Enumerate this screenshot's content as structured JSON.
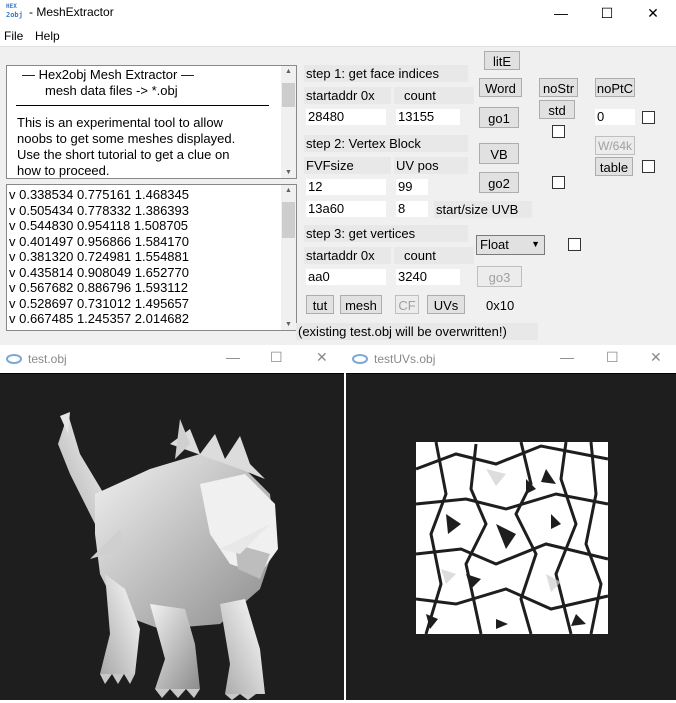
{
  "window": {
    "icon_text_top": "HEX",
    "icon_text_bottom": "2obj",
    "title": "- MeshExtractor",
    "minimize": "—",
    "maximize": "☐",
    "close": "✕"
  },
  "menu": {
    "file": "File",
    "help": "Help"
  },
  "info_panel": {
    "heading_line1": "—   Hex2obj Mesh Extractor   —",
    "heading_line2": "mesh data files -> *.obj",
    "body_lines": [
      "This is an experimental tool to allow",
      "noobs to get some meshes displayed.",
      "Use the short tutorial to get a clue on",
      "how to proceed."
    ]
  },
  "vertex_list": [
    "v 0.338534 0.775161 1.468345",
    "v 0.505434 0.778332 1.386393",
    "v 0.544830 0.954118 1.508705",
    "v 0.401497 0.956866 1.584170",
    "v 0.381320 0.724981 1.554881",
    "v 0.435814 0.908049 1.652770",
    "v 0.567682 0.886796 1.593112",
    "v 0.528697 0.731012 1.495657",
    "v 0.667485 1.245357 2.014682"
  ],
  "step1": {
    "title": "step 1: get face indices",
    "startaddr_label": "startaddr 0x",
    "count_label": "count",
    "startaddr": "28480",
    "count": "13155"
  },
  "step2": {
    "title": "step 2: Vertex Block",
    "fvf_label": "FVFsize",
    "uvpos_label": "UV pos",
    "fvf": "12",
    "uvpos": "99",
    "uvb_start": "13a60",
    "uvb_size": "8",
    "uvb_label": "start/size UVB"
  },
  "step3": {
    "title": "step 3: get vertices",
    "startaddr_label": "startaddr 0x",
    "count_label": "count",
    "startaddr": "aa0",
    "count": "3240"
  },
  "buttons": {
    "litE": "litE",
    "word": "Word",
    "noStr": "noStr",
    "noPtC": "noPtC",
    "go1": "go1",
    "std": "std",
    "vb": "VB",
    "w64k": "W/64k",
    "table": "table",
    "go2": "go2",
    "go3": "go3",
    "tut": "tut",
    "mesh": "mesh",
    "cf": "CF",
    "uvs": "UVs"
  },
  "right_field": "0",
  "format_select": "Float",
  "hex_readout": "0x10",
  "warning": "(existing test.obj will be overwritten!)",
  "child_windows": {
    "left": {
      "title": "test.obj"
    },
    "right": {
      "title": "testUVs.obj"
    }
  },
  "colors": {
    "gl_background": "#1e1e1e",
    "mesh": "#d8d8d8",
    "uv": "#ffffff"
  }
}
